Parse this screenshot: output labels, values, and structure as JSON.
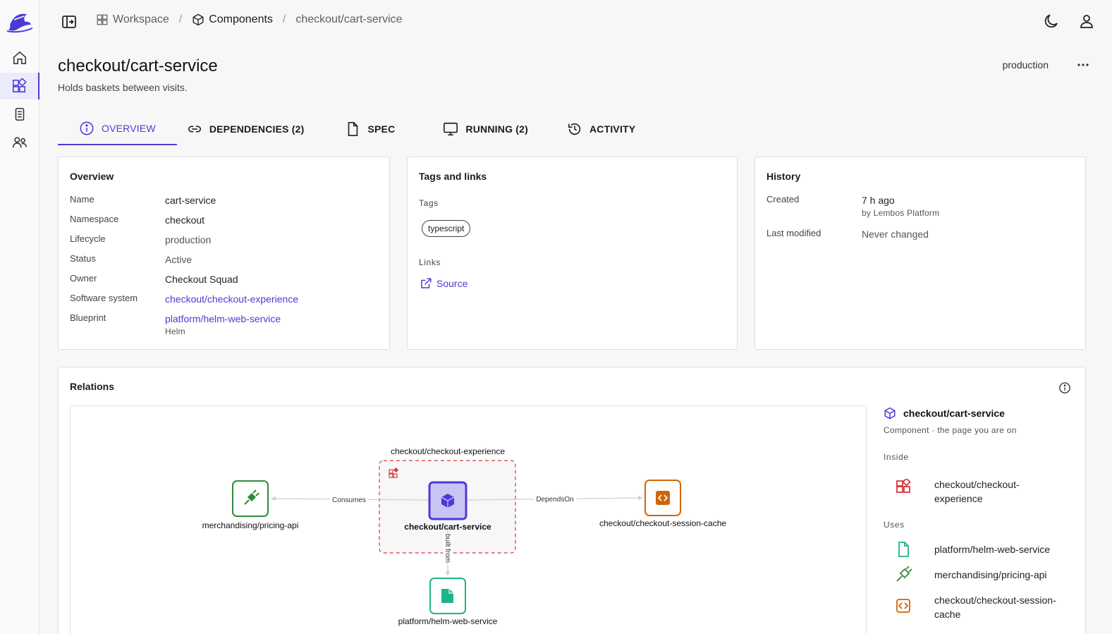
{
  "breadcrumb": {
    "workspace": "Workspace",
    "components": "Components",
    "current": "checkout/cart-service"
  },
  "header": {
    "title": "checkout/cart-service",
    "subtitle": "Holds baskets between visits.",
    "environment": "production"
  },
  "tabs": [
    {
      "label": "OVERVIEW",
      "icon": "info-icon"
    },
    {
      "label": "DEPENDENCIES (2)",
      "icon": "link-icon"
    },
    {
      "label": "SPEC",
      "icon": "file-icon"
    },
    {
      "label": "RUNNING (2)",
      "icon": "monitor-icon"
    },
    {
      "label": "ACTIVITY",
      "icon": "history-icon"
    }
  ],
  "overview": {
    "title": "Overview",
    "rows": [
      {
        "label": "Name",
        "value": "cart-service"
      },
      {
        "label": "Namespace",
        "value": "checkout"
      },
      {
        "label": "Lifecycle",
        "value": "production"
      },
      {
        "label": "Status",
        "value": "Active"
      },
      {
        "label": "Owner",
        "value": "Checkout Squad"
      },
      {
        "label": "Software system",
        "value": "checkout/checkout-experience"
      },
      {
        "label": "Blueprint",
        "value": "platform/helm-web-service",
        "sub": "Helm"
      }
    ]
  },
  "tags_links": {
    "title": "Tags and links",
    "tags_label": "Tags",
    "tags": [
      "typescript"
    ],
    "links_label": "Links",
    "links": [
      {
        "label": "Source",
        "icon": "external-link-icon"
      }
    ]
  },
  "history": {
    "title": "History",
    "created_label": "Created",
    "created_value": "7 h ago",
    "created_by": "by Lembos Platform",
    "modified_label": "Last modified",
    "modified_value": "Never changed"
  },
  "relations": {
    "title": "Relations",
    "graph": {
      "group_label": "checkout/checkout-experience",
      "center": "checkout/cart-service",
      "left": "merchandising/pricing-api",
      "right": "checkout/checkout-session-cache",
      "bottom": "platform/helm-web-service",
      "edge_left": "Consumes",
      "edge_right": "DependsOn",
      "edge_bottom": "built from"
    },
    "panel": {
      "name": "checkout/cart-service",
      "kind": "Component · the page you are on",
      "inside_label": "Inside",
      "inside": [
        {
          "name": "checkout/checkout-\nexperience",
          "icon": "system-icon"
        }
      ],
      "uses_label": "Uses",
      "uses": [
        {
          "name": "platform/helm-web-service",
          "icon": "file-icon"
        },
        {
          "name": "merchandising/pricing-api",
          "icon": "plug-icon"
        },
        {
          "name": "checkout/checkout-session-\ncache",
          "icon": "code-icon"
        }
      ]
    }
  },
  "colors": {
    "accent": "#4b3bd6",
    "api_green": "#2e8b3a",
    "resource_orange": "#d0650a",
    "template_teal": "#1fb48a",
    "system_red": "#d9363e"
  }
}
